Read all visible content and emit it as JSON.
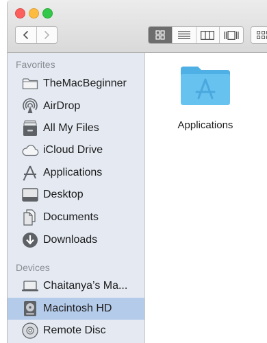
{
  "sidebar": {
    "favorites_header": "Favorites",
    "devices_header": "Devices",
    "favorites": [
      {
        "label": "TheMacBeginner",
        "icon": "folder-icon"
      },
      {
        "label": "AirDrop",
        "icon": "airdrop-icon"
      },
      {
        "label": "All My Files",
        "icon": "all-files-icon"
      },
      {
        "label": "iCloud Drive",
        "icon": "cloud-icon"
      },
      {
        "label": "Applications",
        "icon": "applications-icon"
      },
      {
        "label": "Desktop",
        "icon": "desktop-icon"
      },
      {
        "label": "Documents",
        "icon": "documents-icon"
      },
      {
        "label": "Downloads",
        "icon": "downloads-icon"
      }
    ],
    "devices": [
      {
        "label": "Chaitanya’s Ma...",
        "icon": "laptop-icon"
      },
      {
        "label": "Macintosh HD",
        "icon": "hard-drive-icon",
        "selected": true
      },
      {
        "label": "Remote Disc",
        "icon": "disc-icon"
      }
    ]
  },
  "content": {
    "items": [
      {
        "label": "Applications",
        "icon": "applications-folder-icon"
      }
    ]
  },
  "colors": {
    "sidebar_bg": "#e4e9f2",
    "selection": "#b5cbea",
    "folder_blue": "#67c0ee",
    "active_view": "#6d6d6d"
  }
}
